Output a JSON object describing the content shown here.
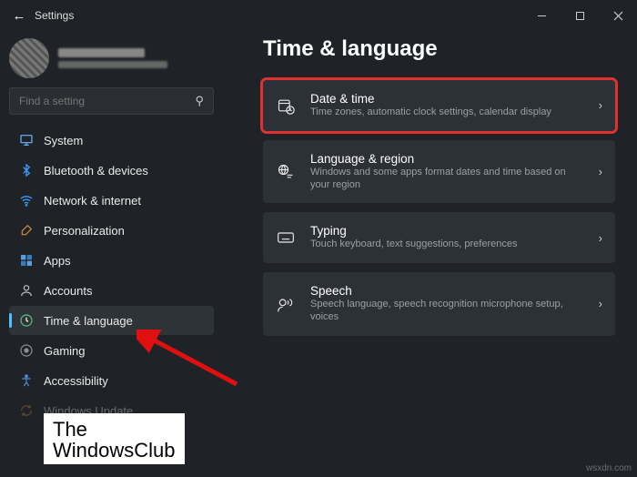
{
  "window": {
    "title": "Settings"
  },
  "profile": {
    "name_redacted": true
  },
  "search": {
    "placeholder": "Find a setting"
  },
  "sidebar": {
    "items": [
      {
        "label": "System"
      },
      {
        "label": "Bluetooth & devices"
      },
      {
        "label": "Network & internet"
      },
      {
        "label": "Personalization"
      },
      {
        "label": "Apps"
      },
      {
        "label": "Accounts"
      },
      {
        "label": "Time & language"
      },
      {
        "label": "Gaming"
      },
      {
        "label": "Accessibility"
      },
      {
        "label": "Windows Update"
      }
    ],
    "selected_index": 6
  },
  "page": {
    "heading": "Time & language",
    "cards": [
      {
        "title": "Date & time",
        "subtitle": "Time zones, automatic clock settings, calendar display"
      },
      {
        "title": "Language & region",
        "subtitle": "Windows and some apps format dates and time based on your region"
      },
      {
        "title": "Typing",
        "subtitle": "Touch keyboard, text suggestions, preferences"
      },
      {
        "title": "Speech",
        "subtitle": "Speech language, speech recognition microphone setup, voices"
      }
    ],
    "highlight_index": 0
  },
  "overlay": {
    "line1": "The",
    "line2": "WindowsClub"
  },
  "watermark": "wsxdn.com"
}
